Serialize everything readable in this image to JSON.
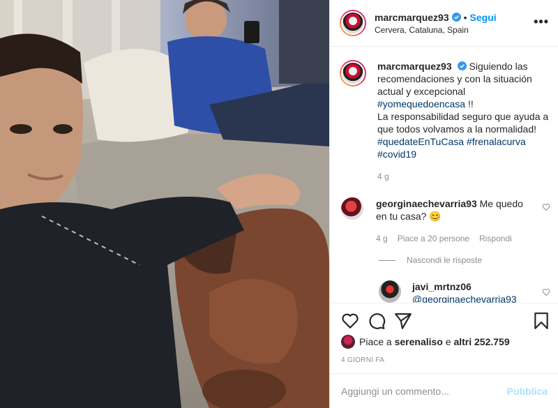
{
  "post": {
    "username": "marcmarquez93",
    "follow_label": "Segui",
    "separator": "•",
    "location": "Cervera, Cataluna, Spain",
    "more_label": "•••",
    "caption_parts": {
      "text1": "Siguiendo las recomendaciones y con la situación actual y excepcional",
      "tag1": "#yomequedoencasa",
      "text2": " !!",
      "text3": "La responsabilidad seguro que ayuda a que todos volvamos a la normalidad!",
      "tag2": "#quedateEnTuCasa",
      "tag3": "#frenalacurva",
      "tag4": "#covid19"
    },
    "caption_age": "4 g"
  },
  "comment": {
    "username": "georginaechevarria93",
    "text": "Me quedo en tu casa? 😊",
    "age": "4 g",
    "likes": "Piace a 20 persone",
    "reply_label": "Rispondi",
    "hide_replies": "Nascondi le risposte"
  },
  "reply": {
    "username": "javi_mrtnz06",
    "mention": "@georginaechevarria93"
  },
  "likes": {
    "prefix": "Piace a",
    "user": "serenaliso",
    "middle": "e",
    "others": "altri 252.759"
  },
  "time_ago": "4 GIORNI FA",
  "add_comment": {
    "placeholder": "Aggiungi un commento...",
    "publish_label": "Pubblica"
  },
  "icons": [
    "verified-icon",
    "more-icon",
    "heart-icon",
    "comment-icon",
    "share-icon",
    "bookmark-icon"
  ],
  "colors": {
    "link_blue": "#0095f6",
    "hashtag_blue": "#00376b",
    "muted": "#8e8e8e",
    "publish_disabled": "#b2dffc"
  }
}
